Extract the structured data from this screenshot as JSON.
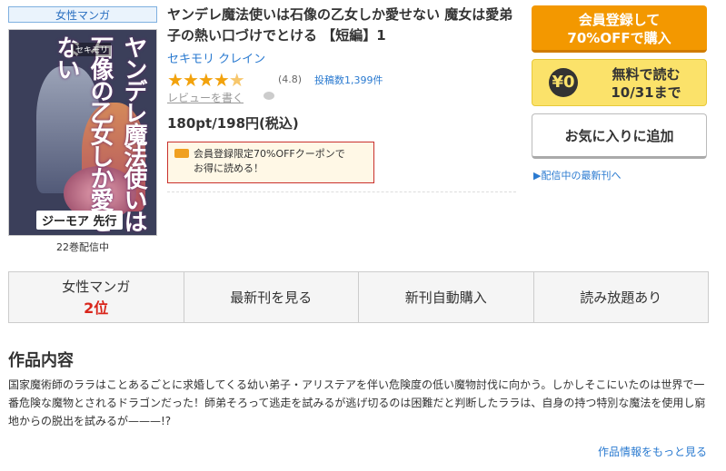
{
  "category_badge": "女性マンガ",
  "cover": {
    "title_text": "ヤンデレ魔法使いは石像の乙女しか愛せない",
    "author_text": "セキモリ",
    "label_text": "ジーモア 先行"
  },
  "volume_count": "22巻配信中",
  "product": {
    "title": "ヤンデレ魔法使いは石像の乙女しか愛せない 魔女は愛弟子の熱い口づけでとける 【短編】1",
    "author": "セキモリ クレイン",
    "rating_value": 4.8,
    "rating_text": "(4.8)",
    "reviews_text": "投稿数1,399件",
    "review_link": "レビューを書く",
    "price": "180pt/198円(税込)",
    "coupon_line1": "会員登録限定70%OFFクーポンで",
    "coupon_line2": "お得に読める！"
  },
  "buttons": {
    "register_line1": "会員登録して",
    "register_line2": "70%OFFで購入",
    "free_yen": "¥0",
    "free_line1": "無料で読む",
    "free_line2": "10/31まで",
    "favorite": "お気に入りに追加",
    "latest_link": "▶配信中の最新刊へ"
  },
  "tabs": {
    "ranking_label": "女性マンガ",
    "ranking_value": "2位",
    "latest": "最新刊を見る",
    "auto_purchase": "新刊自動購入",
    "unlimited": "読み放題あり"
  },
  "section": {
    "title": "作品内容",
    "description": "国家魔術師のララはことあるごとに求婚してくる幼い弟子・アリステアを伴い危険度の低い魔物討伐に向かう。しかしそこにいたのは世界で一番危険な魔物とされるドラゴンだった！師弟そろって逃走を試みるが逃げ切るのは困難だと判断したララは、自身の持つ特別な魔法を使用し窮地からの脱出を試みるが———!?",
    "more_link": "作品情報をもっと見る"
  },
  "colors": {
    "register_button": "#f39800",
    "free_button": "#fbe26a",
    "link": "#2a7ad0",
    "star": "#f2a20c",
    "rank": "#d9261c"
  }
}
